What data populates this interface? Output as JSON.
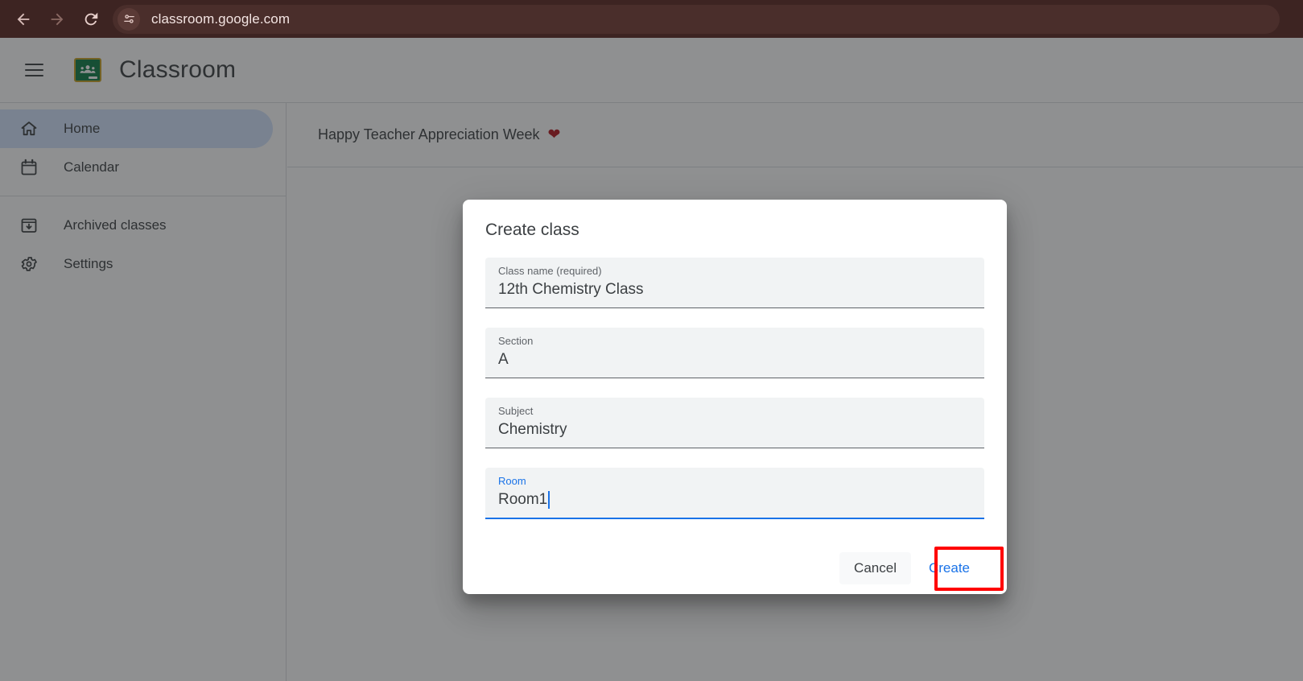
{
  "browser": {
    "back_icon": "arrow-left-icon",
    "forward_icon": "arrow-right-icon",
    "reload_icon": "reload-icon",
    "site_settings_icon": "tune-sliders-icon",
    "url": "classroom.google.com"
  },
  "header": {
    "menu_icon": "hamburger-menu-icon",
    "logo_icon": "google-classroom-logo-icon",
    "title": "Classroom"
  },
  "sidebar": {
    "items": [
      {
        "label": "Home",
        "icon": "home-icon",
        "active": true
      },
      {
        "label": "Calendar",
        "icon": "calendar-icon",
        "active": false
      },
      {
        "label": "Archived classes",
        "icon": "archive-box-icon",
        "active": false
      },
      {
        "label": "Settings",
        "icon": "gear-icon",
        "active": false
      }
    ]
  },
  "banner": {
    "text": "Happy Teacher Appreciation Week",
    "heart": "❤",
    "heart_icon": "red-heart-icon"
  },
  "dialog": {
    "title": "Create class",
    "fields": [
      {
        "label": "Class name (required)",
        "value": "12th Chemistry Class",
        "focused": false
      },
      {
        "label": "Section",
        "value": "A",
        "focused": false
      },
      {
        "label": "Subject",
        "value": "Chemistry",
        "focused": false
      },
      {
        "label": "Room",
        "value": "Room1",
        "focused": true
      }
    ],
    "cancel_label": "Cancel",
    "create_label": "Create"
  },
  "colors": {
    "browser_chrome": "#3d2422",
    "accent_blue": "#1a73e8",
    "active_nav": "#d2e3fc",
    "field_background": "#f1f3f4",
    "highlight_red": "#ff0000",
    "logo_green": "#0f7c46",
    "heart_red": "#b3171f"
  }
}
